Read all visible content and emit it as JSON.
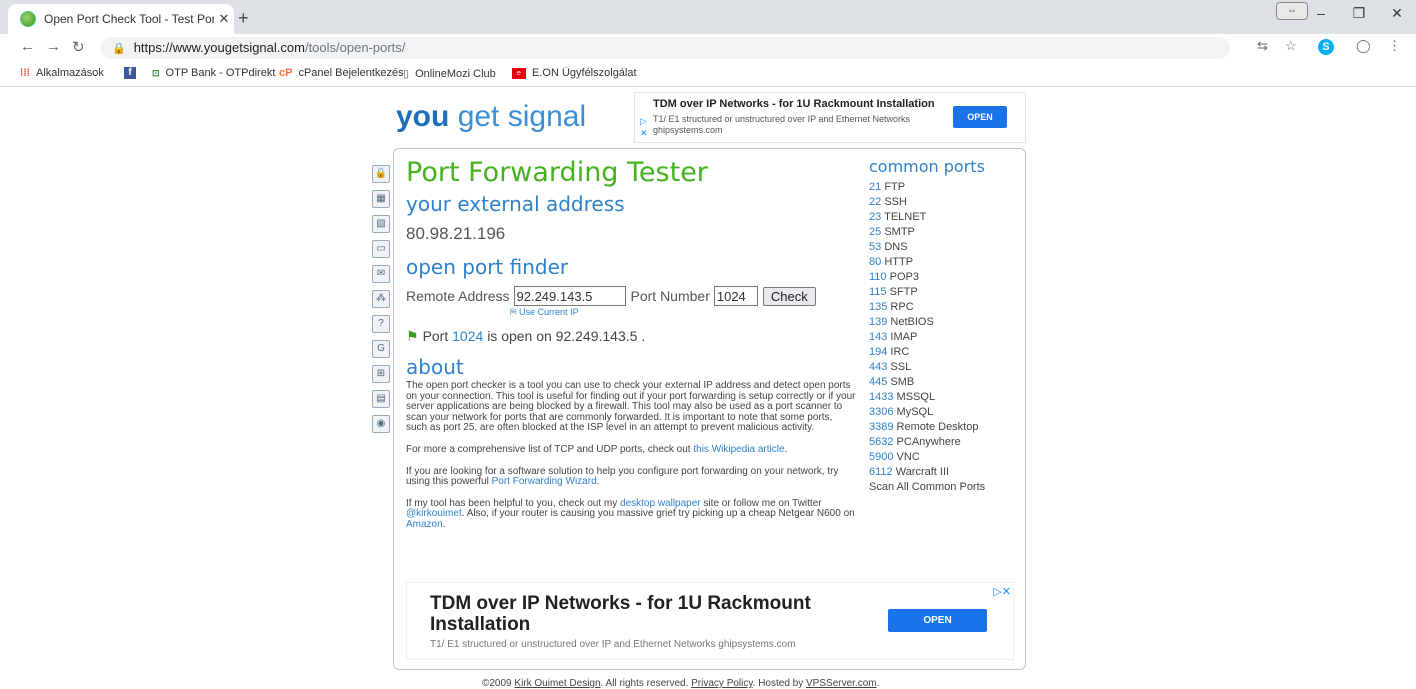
{
  "browser": {
    "tab_title": "Open Port Check Tool - Test Port",
    "tab_close": "✕",
    "new_tab": "+",
    "url_domain": "https://www.yougetsignal.com",
    "url_path": "/tools/open-ports/",
    "bookmarks": [
      {
        "label": "Alkalmazások",
        "icon": "apps-icon"
      },
      {
        "label": "",
        "icon": "facebook-icon"
      },
      {
        "label": "OTP Bank - OTPdirekt",
        "icon": "otp-icon"
      },
      {
        "label": "cPanel Bejelentkezés",
        "icon": "cpanel-icon"
      },
      {
        "label": "OnlineMozi Club",
        "icon": "page-icon"
      },
      {
        "label": "E.ON Ügyfélszolgálat",
        "icon": "eon-icon"
      }
    ]
  },
  "logo": {
    "you": "you",
    "get": "get",
    "signal": "signal"
  },
  "top_ad": {
    "heading": "TDM over IP Networks - for 1U Rackmount Installation",
    "desc": "T1/ E1 structured or unstructured over IP and Ethernet Networks",
    "url": "ghipsystems.com",
    "button": "OPEN"
  },
  "main": {
    "title": "Port Forwarding Tester",
    "external_heading": "your external address",
    "external_ip": "80.98.21.196",
    "finder_heading": "open port finder",
    "remote_label": "Remote Address",
    "remote_value": "92.249.143.5",
    "port_label": "Port Number",
    "port_value": "1024",
    "check_label": "Check",
    "use_current": "Use Current IP",
    "result_prefix": "Port",
    "result_port": "1024",
    "result_suffix": "is open on 92.249.143.5 .",
    "about_heading": "about",
    "about_p1": "The open port checker is a tool you can use to check your external IP address and detect open ports on your connection. This tool is useful for finding out if your port forwarding is setup correctly or if your server applications are being blocked by a firewall. This tool may also be used as a port scanner to scan your network for ports that are commonly forwarded. It is important to note that some ports, such as port 25, are often blocked at the ISP level in an attempt to prevent malicious activity.",
    "about_p2_pre": "For more a comprehensive list of TCP and UDP ports, check out",
    "about_p2_link": "this Wikipedia article",
    "about_p2_post": ".",
    "about_p3_pre": "If you are looking for a software solution to help you configure port forwarding on your network, try using this powerful",
    "about_p3_link": "Port Forwarding Wizard",
    "about_p3_post": ".",
    "about_p4_a": "If my tool has been helpful to you, check out my",
    "about_p4_link1": "desktop wallpaper",
    "about_p4_b": "site or follow me on Twitter",
    "about_p4_link2": "@kirkouimet",
    "about_p4_c": ". Also, if your router is causing you massive grief try picking up a cheap Netgear N600 on",
    "about_p4_link3": "Amazon",
    "about_p4_d": "."
  },
  "common_ports": {
    "heading": "common ports",
    "items": [
      {
        "num": "21",
        "name": "FTP"
      },
      {
        "num": "22",
        "name": "SSH"
      },
      {
        "num": "23",
        "name": "TELNET"
      },
      {
        "num": "25",
        "name": "SMTP"
      },
      {
        "num": "53",
        "name": "DNS"
      },
      {
        "num": "80",
        "name": "HTTP"
      },
      {
        "num": "110",
        "name": "POP3"
      },
      {
        "num": "115",
        "name": "SFTP"
      },
      {
        "num": "135",
        "name": "RPC"
      },
      {
        "num": "139",
        "name": "NetBIOS"
      },
      {
        "num": "143",
        "name": "IMAP"
      },
      {
        "num": "194",
        "name": "IRC"
      },
      {
        "num": "443",
        "name": "SSL"
      },
      {
        "num": "445",
        "name": "SMB"
      },
      {
        "num": "1433",
        "name": "MSSQL"
      },
      {
        "num": "3306",
        "name": "MySQL"
      },
      {
        "num": "3389",
        "name": "Remote Desktop"
      },
      {
        "num": "5632",
        "name": "PCAnywhere"
      },
      {
        "num": "5900",
        "name": "VNC"
      },
      {
        "num": "6112",
        "name": "Warcraft III"
      }
    ],
    "scan_all": "Scan All Common Ports"
  },
  "bottom_ad": {
    "heading": "TDM over IP Networks - for 1U Rackmount Installation",
    "desc": "T1/ E1 structured or unstructured over IP and Ethernet Networks ghipsystems.com",
    "button": "OPEN"
  },
  "footer": {
    "pre": "©2009",
    "link1": "Kirk Ouimet Design",
    "mid1": ". All rights reserved.",
    "link2": "Privacy Policy",
    "mid2": ". Hosted by",
    "link3": "VPSServer.com",
    "post": "."
  }
}
